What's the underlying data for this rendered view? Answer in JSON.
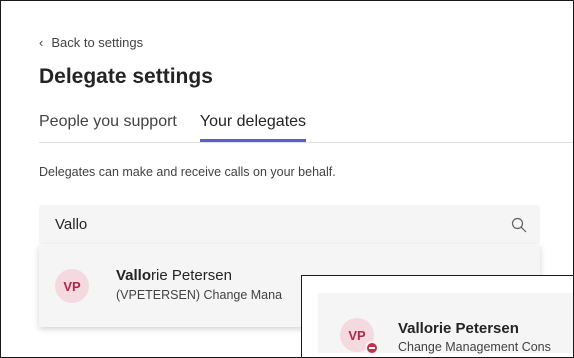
{
  "header": {
    "back_label": "Back to settings",
    "title": "Delegate settings"
  },
  "tabs": [
    {
      "label": "People you support",
      "active": false
    },
    {
      "label": "Your delegates",
      "active": true
    }
  ],
  "description": "Delegates can make and receive calls on your behalf.",
  "search": {
    "value": "Vallo",
    "placeholder": ""
  },
  "search_result": {
    "initials": "VP",
    "name_match": "Vallo",
    "name_rest": "rie Petersen",
    "subtitle": "(VPETERSEN) Change Mana"
  },
  "hover_card": {
    "initials": "VP",
    "name": "Vallorie Petersen",
    "subtitle": "Change Management Cons",
    "presence": "do-not-disturb"
  },
  "colors": {
    "accent": "#5b5fc7",
    "avatar_bg": "#f4d9e0",
    "avatar_text": "#b3264a",
    "presence_dnd": "#c4314b"
  },
  "icons": {
    "back": "chevron-left-icon",
    "search": "search-icon",
    "presence": "do-not-disturb-icon"
  }
}
